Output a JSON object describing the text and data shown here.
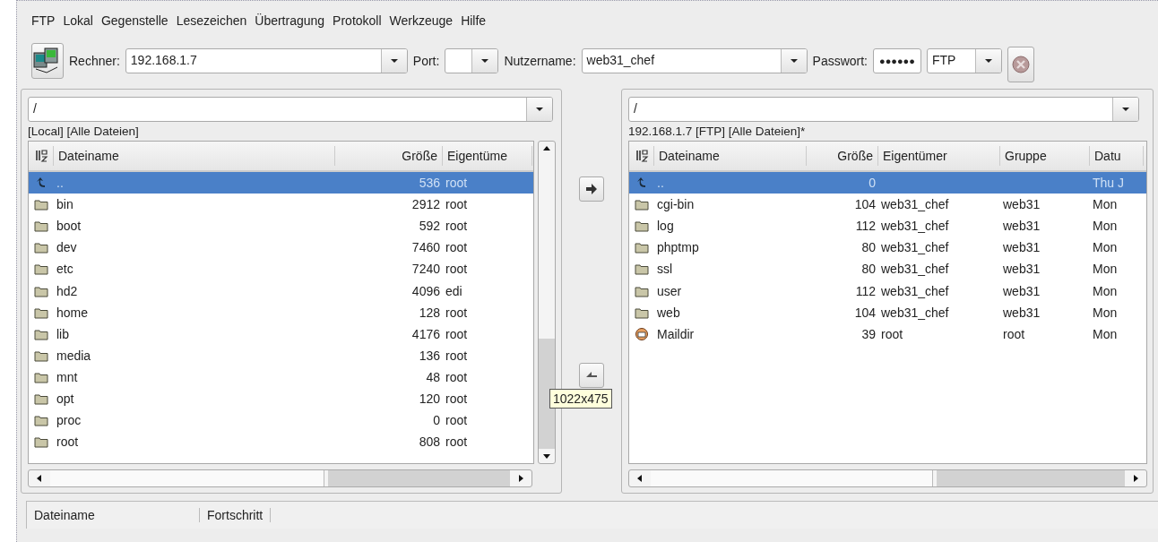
{
  "menu": [
    "FTP",
    "Lokal",
    "Gegenstelle",
    "Lesezeichen",
    "Übertragung",
    "Protokoll",
    "Werkzeuge",
    "Hilfe"
  ],
  "toolbar": {
    "host_label": "Rechner:",
    "host": "192.168.1.7",
    "port_label": "Port:",
    "user_label": "Nutzername:",
    "user": "web31_chef",
    "password_label": "Passwort:",
    "password_dots": "●●●●●●",
    "protocol": "FTP"
  },
  "local": {
    "path": "/",
    "caption": "[Local] [Alle Dateien]",
    "columns": [
      "Dateiname",
      "Größe",
      "Eigentüme"
    ],
    "rows": [
      {
        "kind": "parent",
        "name": "..",
        "size": "536",
        "owner": "root",
        "selected": true
      },
      {
        "kind": "folder",
        "name": "bin",
        "size": "2912",
        "owner": "root",
        "selected": false
      },
      {
        "kind": "folder",
        "name": "boot",
        "size": "592",
        "owner": "root",
        "selected": false
      },
      {
        "kind": "folder",
        "name": "dev",
        "size": "7460",
        "owner": "root",
        "selected": false
      },
      {
        "kind": "folder",
        "name": "etc",
        "size": "7240",
        "owner": "root",
        "selected": false
      },
      {
        "kind": "folder",
        "name": "hd2",
        "size": "4096",
        "owner": "edi",
        "selected": false
      },
      {
        "kind": "folder",
        "name": "home",
        "size": "128",
        "owner": "root",
        "selected": false
      },
      {
        "kind": "folder",
        "name": "lib",
        "size": "4176",
        "owner": "root",
        "selected": false
      },
      {
        "kind": "folder",
        "name": "media",
        "size": "136",
        "owner": "root",
        "selected": false
      },
      {
        "kind": "folder",
        "name": "mnt",
        "size": "48",
        "owner": "root",
        "selected": false
      },
      {
        "kind": "folder",
        "name": "opt",
        "size": "120",
        "owner": "root",
        "selected": false
      },
      {
        "kind": "folder",
        "name": "proc",
        "size": "0",
        "owner": "root",
        "selected": false
      },
      {
        "kind": "folder",
        "name": "root",
        "size": "808",
        "owner": "root",
        "selected": false
      }
    ]
  },
  "remote": {
    "path": "/",
    "caption": "192.168.1.7 [FTP] [Alle Dateien]*",
    "columns": [
      "Dateiname",
      "Größe",
      "Eigentümer",
      "Gruppe",
      "Datu"
    ],
    "rows": [
      {
        "kind": "parent",
        "name": "..",
        "size": "0",
        "date": "Thu J",
        "selected": true
      },
      {
        "kind": "folder",
        "name": "cgi-bin",
        "size": "104",
        "owner": "web31_chef",
        "group": "web31",
        "date": "Mon",
        "selected": false
      },
      {
        "kind": "folder",
        "name": "log",
        "size": "112",
        "owner": "web31_chef",
        "group": "web31",
        "date": "Mon",
        "selected": false
      },
      {
        "kind": "folder",
        "name": "phptmp",
        "size": "80",
        "owner": "web31_chef",
        "group": "web31",
        "date": "Mon",
        "selected": false
      },
      {
        "kind": "folder",
        "name": "ssl",
        "size": "80",
        "owner": "web31_chef",
        "group": "web31",
        "date": "Mon",
        "selected": false
      },
      {
        "kind": "folder",
        "name": "user",
        "size": "112",
        "owner": "web31_chef",
        "group": "web31",
        "date": "Mon",
        "selected": false
      },
      {
        "kind": "folder",
        "name": "web",
        "size": "104",
        "owner": "web31_chef",
        "group": "web31",
        "date": "Mon",
        "selected": false
      },
      {
        "kind": "mail",
        "name": "Maildir",
        "size": "39",
        "owner": "root",
        "group": "root",
        "date": "Mon",
        "selected": false
      }
    ]
  },
  "tooltip": "1022x475",
  "transfers": {
    "columns": [
      "Dateiname",
      "Fortschritt"
    ]
  }
}
